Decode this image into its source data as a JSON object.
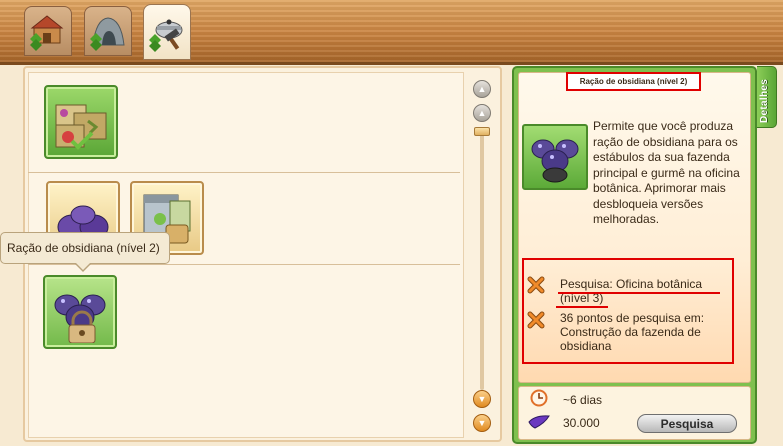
{
  "tabs": [
    {
      "icon": "farm-house-icon"
    },
    {
      "icon": "stone-cave-icon"
    },
    {
      "icon": "cooking-pot-hammer-icon"
    }
  ],
  "tooltip": {
    "text": "Ração de obsidiana (nível 2)"
  },
  "details": {
    "side_tab_label": "Detalhes",
    "title": "Ração de obsidiana (nível 2)",
    "description": "Permite que você produza ração de obsidiana para os estábulos da sua fazenda principal e gurmê na oficina botânica. Aprimorar mais desbloqueia versões melhoradas.",
    "requirements": [
      {
        "line1": "Pesquisa: Oficina botânica",
        "line2": "(nível 3)",
        "icon": "cross-icon"
      },
      {
        "line1": "36 pontos de pesquisa em:",
        "line2": "Construção da fazenda de",
        "line3": "obsidiana",
        "icon": "cross-icon"
      }
    ],
    "duration": "~6 dias",
    "cost": "30.000",
    "research_button": "Pesquisa"
  },
  "colors": {
    "highlight": "#e00000",
    "panel_green": "#7fc04e"
  }
}
